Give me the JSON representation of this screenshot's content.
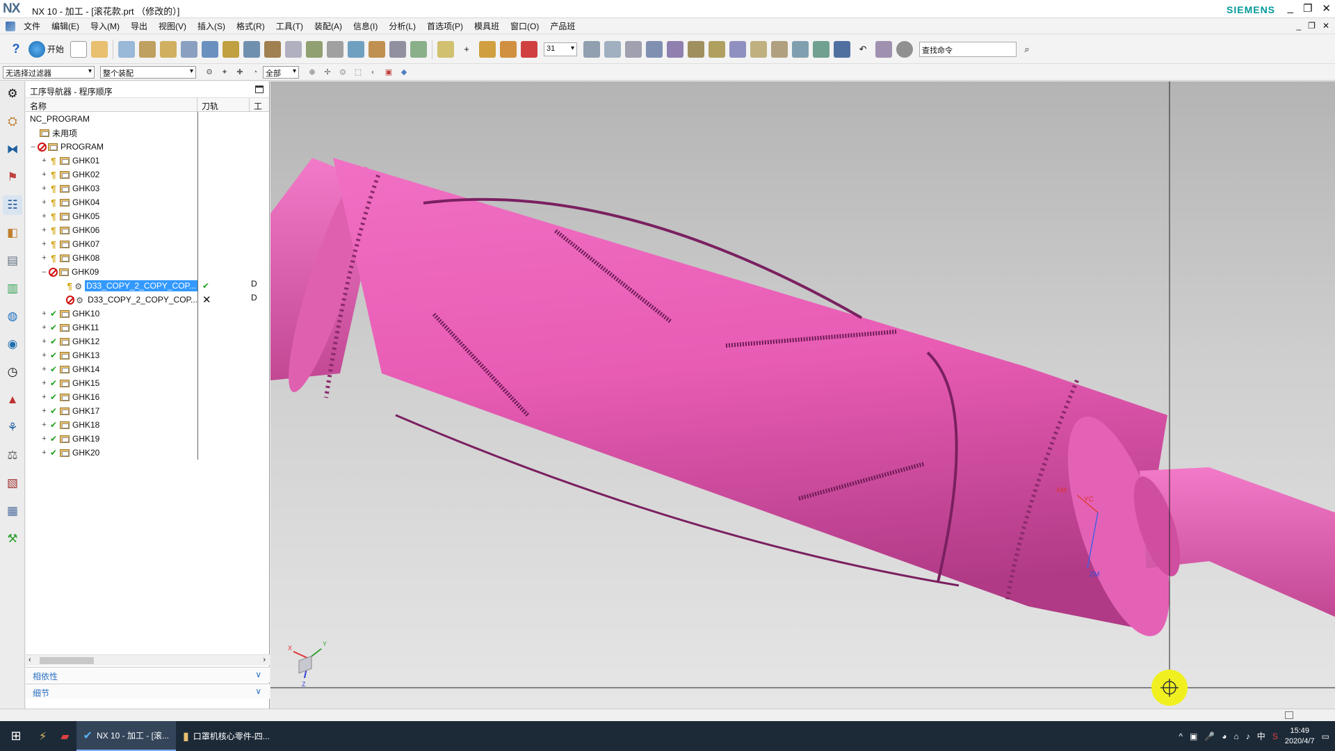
{
  "window": {
    "app_logo": "NX",
    "title": "NX 10 - 加工 - [滚花款.prt （修改的）]",
    "brand": "SIEMENS",
    "minimize": "_",
    "restore": "❐",
    "close": "✕"
  },
  "menu": {
    "items": [
      "文件",
      "编辑(E)",
      "导入(M)",
      "导出",
      "视图(V)",
      "插入(S)",
      "格式(R)",
      "工具(T)",
      "装配(A)",
      "信息(I)",
      "分析(L)",
      "首选项(P)",
      "模具班",
      "窗口(O)",
      "产品班"
    ],
    "mdi_min": "_",
    "mdi_restore": "❐",
    "mdi_close": "✕"
  },
  "toolbar": {
    "help_icon": "?",
    "start_label": "开始",
    "layer_value": "31",
    "search_placeholder": "查找命令"
  },
  "selection_bar": {
    "filter": "无选择过滤器",
    "scope": "整个装配",
    "mode": "全部"
  },
  "navigator": {
    "title": "工序导航器 - 程序顺序",
    "columns": [
      "名称",
      "刀轨",
      "工"
    ],
    "root": "NC_PROGRAM",
    "unused": "未用项",
    "program": "PROGRAM",
    "groups_before": [
      "GHK01",
      "GHK02",
      "GHK03",
      "GHK04",
      "GHK05",
      "GHK06",
      "GHK07",
      "GHK08"
    ],
    "group_expanded": "GHK09",
    "ops": [
      {
        "name": "D33_COPY_2_COPY_COP...",
        "path_status": "✔",
        "tool": "D"
      },
      {
        "name": "D33_COPY_2_COPY_COP...",
        "path_status": "✕",
        "tool": "D"
      }
    ],
    "groups_after": [
      "GHK10",
      "GHK11",
      "GHK12",
      "GHK13",
      "GHK14",
      "GHK15",
      "GHK16",
      "GHK17",
      "GHK18",
      "GHK19",
      "GHK20"
    ],
    "panel_dependency": "相依性",
    "panel_details": "细节"
  },
  "viewport": {
    "wcs_labels": [
      "XM",
      "YC",
      "ZM"
    ],
    "triad_labels": [
      "X",
      "Y",
      "Z"
    ]
  },
  "taskbar": {
    "apps": [
      "NX 10 - 加工 - [滚...",
      "口罩机核心零件-四..."
    ],
    "ime": "中",
    "time": "15:49",
    "date": "2020/4/7"
  },
  "colors": {
    "part": "#e85cb4",
    "selection": "#3399ff",
    "ok_check": "#20a020",
    "no_sign": "#d01010",
    "brand": "#009999"
  }
}
